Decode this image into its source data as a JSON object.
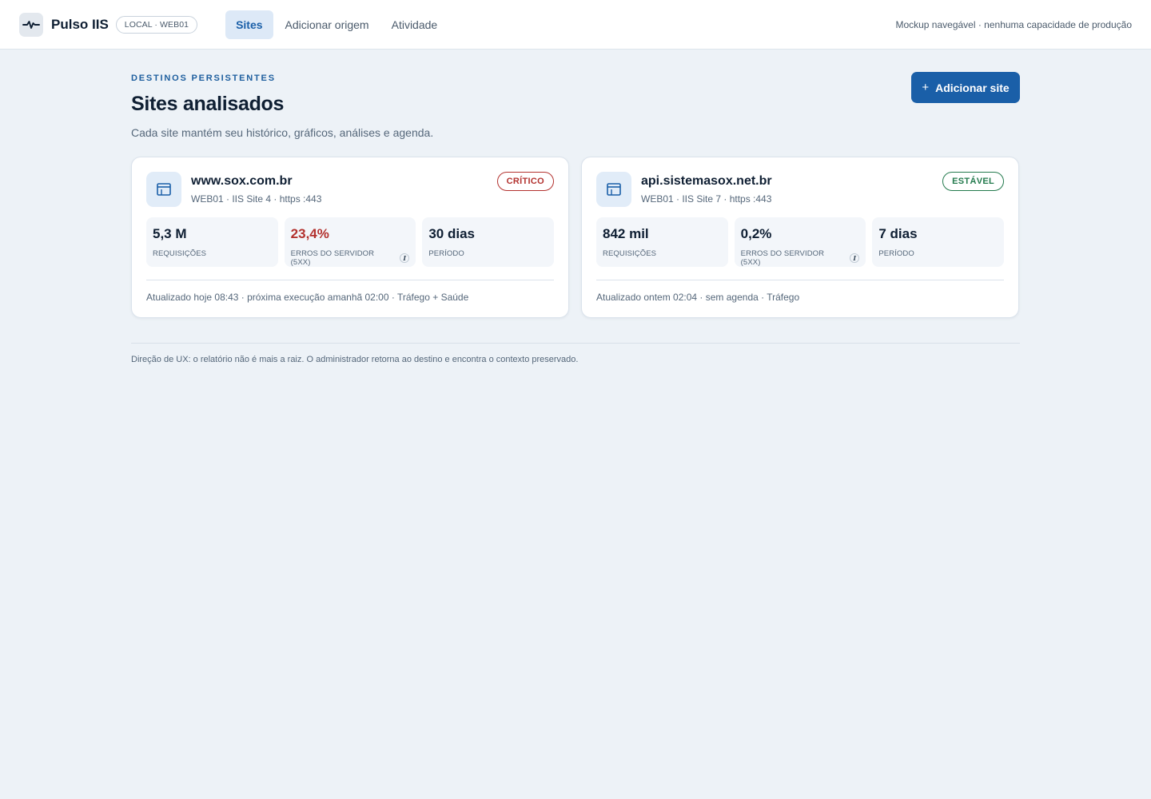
{
  "app": {
    "name": "Pulso IIS",
    "env_badge": "LOCAL · WEB01",
    "note": "Mockup navegável · nenhuma capacidade de produção"
  },
  "nav": {
    "items": [
      {
        "label": "Sites",
        "active": true
      },
      {
        "label": "Adicionar origem",
        "active": false
      },
      {
        "label": "Atividade",
        "active": false
      }
    ]
  },
  "header": {
    "eyebrow": "DESTINOS PERSISTENTES",
    "title": "Sites analisados",
    "subtitle": "Cada site mantém seu histórico, gráficos, análises e agenda.",
    "add_button": "Adicionar site",
    "add_button_icon": "+"
  },
  "sites": [
    {
      "name": "www.sox.com.br",
      "meta": "WEB01 · IIS Site 4 · https :443",
      "status": "CRÍTICO",
      "status_color": "#b3322f",
      "metrics": [
        {
          "value": "5,3 M",
          "label": "REQUISIÇÕES"
        },
        {
          "value": "23,4%",
          "label": "ERROS DO SERVIDOR (5XX)",
          "info_icon": "i",
          "value_color": "#b3322f"
        },
        {
          "value": "30 dias",
          "label": "PERÍODO"
        }
      ],
      "footer": "Atualizado hoje 08:43 · próxima execução amanhã 02:00 · Tráfego + Saúde"
    },
    {
      "name": "api.sistemasox.net.br",
      "meta": "WEB01 · IIS Site 7 · https :443",
      "status": "ESTÁVEL",
      "status_color": "#237a4d",
      "metrics": [
        {
          "value": "842 mil",
          "label": "REQUISIÇÕES"
        },
        {
          "value": "0,2%",
          "label": "ERROS DO SERVIDOR (5XX)",
          "info_icon": "i"
        },
        {
          "value": "7 dias",
          "label": "PERÍODO"
        }
      ],
      "footer": "Atualizado ontem 02:04 · sem agenda · Tráfego"
    }
  ],
  "footer_note": "Direção de UX: o relatório não é mais a raiz. O administrador retorna ao destino e encontra o contexto preservado.",
  "colors": {
    "accent": "#1a5fa8",
    "background": "#edf2f7",
    "critical": "#b3322f",
    "stable": "#237a4d"
  }
}
